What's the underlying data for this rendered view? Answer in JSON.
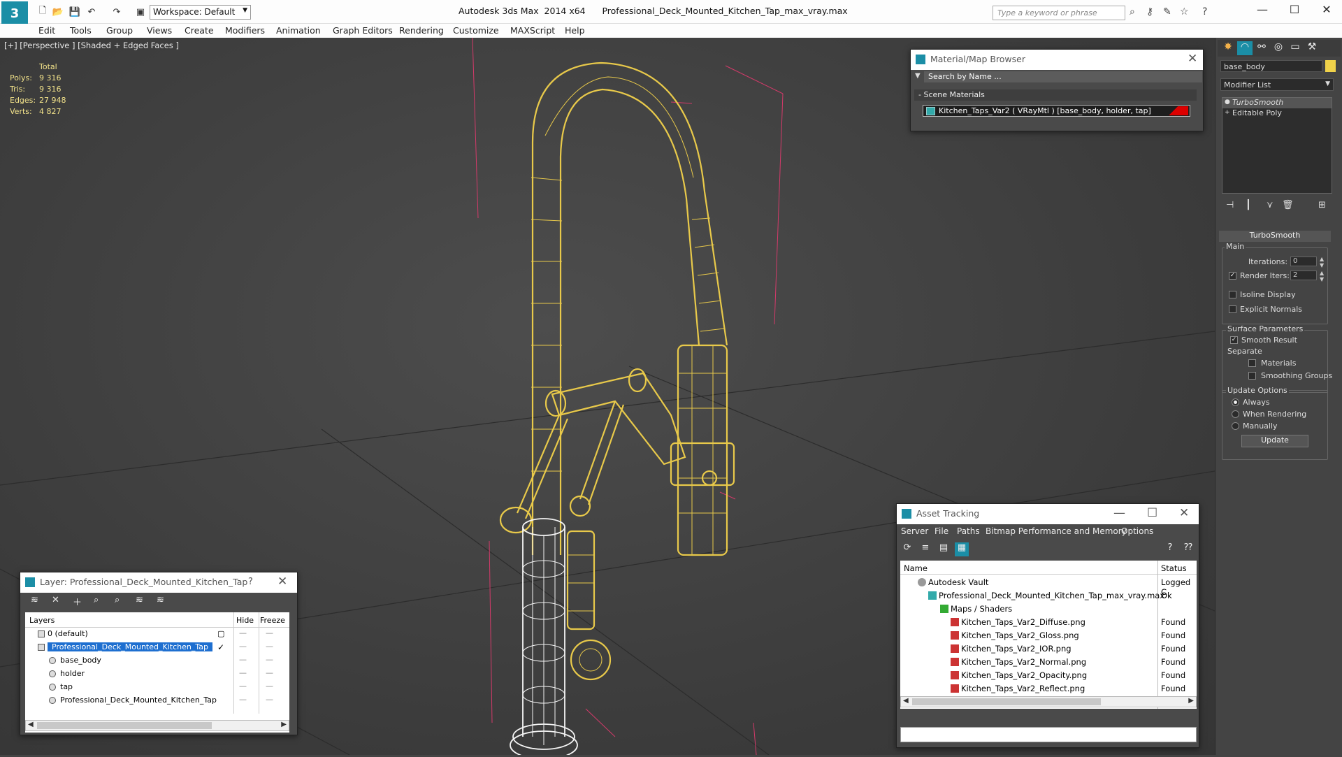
{
  "titlebar": {
    "app_logo": "3",
    "workspace": "Workspace: Default",
    "title": "Autodesk 3ds Max  2014 x64      Professional_Deck_Mounted_Kitchen_Tap_max_vray.max",
    "search_placeholder": "Type a keyword or phrase"
  },
  "menu": [
    "Edit",
    "Tools",
    "Group",
    "Views",
    "Create",
    "Modifiers",
    "Animation",
    "Graph Editors",
    "Rendering",
    "Customize",
    "MAXScript",
    "Help"
  ],
  "viewport": {
    "label": "[+] [Perspective ] [Shaded + Edged Faces ]",
    "stats": {
      "header": "Total",
      "rows": [
        {
          "key": "Polys:",
          "value": "9 316"
        },
        {
          "key": "Tris:",
          "value": "9 316"
        },
        {
          "key": "Edges:",
          "value": "27 948"
        },
        {
          "key": "Verts:",
          "value": "4 827"
        }
      ]
    }
  },
  "command_panel": {
    "object_name": "base_body",
    "object_color": "#f0d24a",
    "modifier_list_label": "Modifier List",
    "stack": [
      {
        "label": "TurboSmooth",
        "selected": true
      },
      {
        "label": "Editable Poly",
        "selected": false
      }
    ],
    "turbosmooth": {
      "title": "TurboSmooth",
      "main_label": "Main",
      "iterations_label": "Iterations:",
      "iterations_value": "0",
      "render_iters_label": "Render Iters:",
      "render_iters_value": "2",
      "isoline_label": "Isoline Display",
      "explicit_normals_label": "Explicit Normals",
      "surface_params_label": "Surface Parameters",
      "smooth_result_label": "Smooth Result",
      "separate_label": "Separate",
      "materials_label": "Materials",
      "smoothing_groups_label": "Smoothing Groups",
      "update_options_label": "Update Options",
      "always_label": "Always",
      "when_rendering_label": "When Rendering",
      "manually_label": "Manually",
      "update_button": "Update"
    }
  },
  "material_browser": {
    "title": "Material/Map Browser",
    "search_placeholder": "Search by Name ...",
    "section": "- Scene Materials",
    "material": "Kitchen_Taps_Var2  ( VRayMtl ) [base_body, holder, tap]"
  },
  "asset_tracking": {
    "title": "Asset Tracking",
    "menu": [
      "Server",
      "File",
      "Paths",
      "Bitmap Performance and Memory",
      "Options"
    ],
    "columns": {
      "name": "Name",
      "status": "Status"
    },
    "rows": [
      {
        "name": "Autodesk Vault",
        "status": "Logged C"
      },
      {
        "name": "Professional_Deck_Mounted_Kitchen_Tap_max_vray.max",
        "status": "Ok"
      },
      {
        "name": "Maps / Shaders",
        "status": ""
      },
      {
        "name": "Kitchen_Taps_Var2_Diffuse.png",
        "status": "Found"
      },
      {
        "name": "Kitchen_Taps_Var2_Gloss.png",
        "status": "Found"
      },
      {
        "name": "Kitchen_Taps_Var2_IOR.png",
        "status": "Found"
      },
      {
        "name": "Kitchen_Taps_Var2_Normal.png",
        "status": "Found"
      },
      {
        "name": "Kitchen_Taps_Var2_Opacity.png",
        "status": "Found"
      },
      {
        "name": "Kitchen_Taps_Var2_Reflect.png",
        "status": "Found"
      }
    ]
  },
  "layer_dialog": {
    "title": "Layer: Professional_Deck_Mounted_Kitchen_Tap",
    "help": "?",
    "columns": {
      "layers": "Layers",
      "hide": "Hide",
      "freeze": "Freeze"
    },
    "rows": [
      {
        "name": "0 (default)"
      },
      {
        "name": "Professional_Deck_Mounted_Kitchen_Tap"
      },
      {
        "name": "base_body"
      },
      {
        "name": "holder"
      },
      {
        "name": "tap"
      },
      {
        "name": "Professional_Deck_Mounted_Kitchen_Tap"
      }
    ]
  },
  "colors": {
    "wire": "#e8c94a",
    "accent": "#1b8ea6",
    "selection": "#1e6fd0"
  }
}
